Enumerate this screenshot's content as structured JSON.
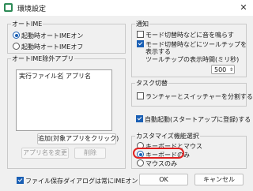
{
  "window": {
    "title": "環境設定",
    "close_glyph": "✕"
  },
  "ime_group": {
    "legend": "オートIME",
    "options": [
      {
        "label": "起動時オートIMEオン",
        "selected": true
      },
      {
        "label": "起動時オートIMEオフ",
        "selected": false
      }
    ]
  },
  "exclude_group": {
    "legend": "オートIME除外アプリ",
    "columns": [
      "実行ファイル名",
      "アプリ名"
    ],
    "add_button": "追加(対象アプリをクリック)",
    "rename_button": "アプリ名を変更",
    "delete_button": "削除"
  },
  "file_dialog_checkbox": {
    "label": "ファイル保存ダイアログは常にIMEオン",
    "checked": true
  },
  "notify_group": {
    "legend": "通知",
    "mode_notify": {
      "label": "モード切替時などに音を鳴らす",
      "checked": false
    },
    "tooltip_line1": "モード切替時などにツールチップを",
    "tooltip_line2": "表示する",
    "tooltip_checked": true,
    "duration_label": "ツールチップの表示時間(ミリ秒)",
    "duration_value": "500"
  },
  "task_group": {
    "legend": "タスク切替",
    "split_label": "ランチャーとスイッチャーを分割する",
    "split_checked": false
  },
  "autostart": {
    "label": "自動起動(スタートアップに登録)する",
    "checked": true
  },
  "feature_group": {
    "legend": "カスタマイズ機能選択",
    "options": [
      {
        "label": "キーボードとマウス",
        "selected": false
      },
      {
        "label": "キーボードのみ",
        "selected": true
      },
      {
        "label": "マウスのみ",
        "selected": false
      }
    ]
  },
  "buttons": {
    "ok": "OK",
    "cancel": "キャンセル"
  },
  "colors": {
    "accent": "#1a5fb4",
    "annotation": "#e02020"
  }
}
